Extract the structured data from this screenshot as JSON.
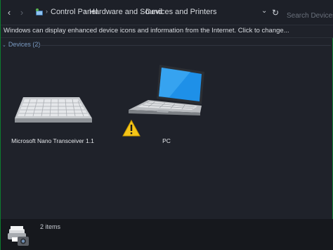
{
  "addressbar": {
    "back": "‹",
    "forward": "›",
    "crumbs": [
      "Control Panel",
      "Hardware and Sound",
      "Devices and Printers"
    ],
    "separator": "›",
    "dropdown": "⌄",
    "refresh": "↻",
    "search_placeholder": "Search Devices and Printers"
  },
  "infobar": {
    "text": "Windows can display enhanced device icons and information from the Internet. Click to change..."
  },
  "group": {
    "chevron": "⌄",
    "label": "Devices (2)"
  },
  "devices": [
    {
      "label": "Microsoft Nano Transceiver 1.1",
      "icon": "keyboard-icon"
    },
    {
      "label": "PC",
      "icon": "laptop-icon",
      "warning": true
    }
  ],
  "statusbar": {
    "count": "2 items",
    "icon": "printer-camera-icon"
  },
  "colors": {
    "background": "#1f222a",
    "accent": "#7b9cc4",
    "border": "#0c7c2e",
    "warning": "#f5c518"
  }
}
